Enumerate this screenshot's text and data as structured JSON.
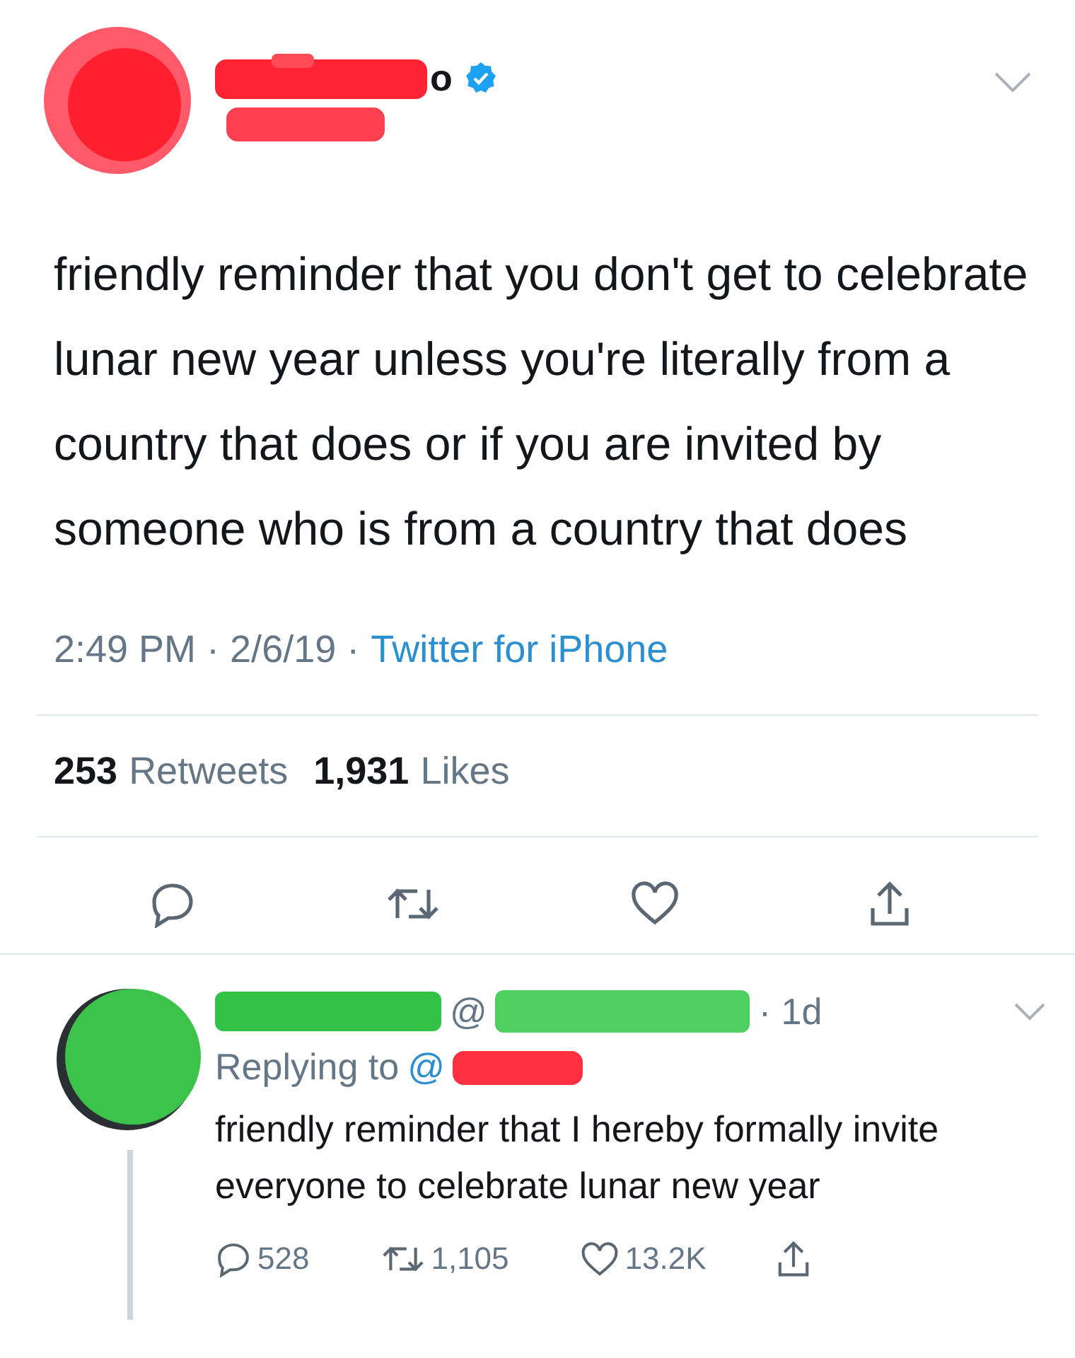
{
  "tweet": {
    "name_visible": "o",
    "verified": true,
    "text": "friendly reminder that you don't get to celebrate lunar new year unless you're literally from a country that does or if you are invited by someone who is from a country that does",
    "meta": "2:49 PM · 2/6/19 ·",
    "source": "Twitter for iPhone",
    "retweets": "253",
    "retweets_label": "Retweets",
    "likes": "1,931",
    "likes_label": "Likes"
  },
  "reply": {
    "at": "@",
    "age": "· 1d",
    "replying_label": "Replying to",
    "replying_at": "@",
    "text": "friendly reminder that I hereby formally invite everyone to celebrate lunar new year",
    "replies": "528",
    "retweets": "1,105",
    "likes": "13.2K"
  }
}
